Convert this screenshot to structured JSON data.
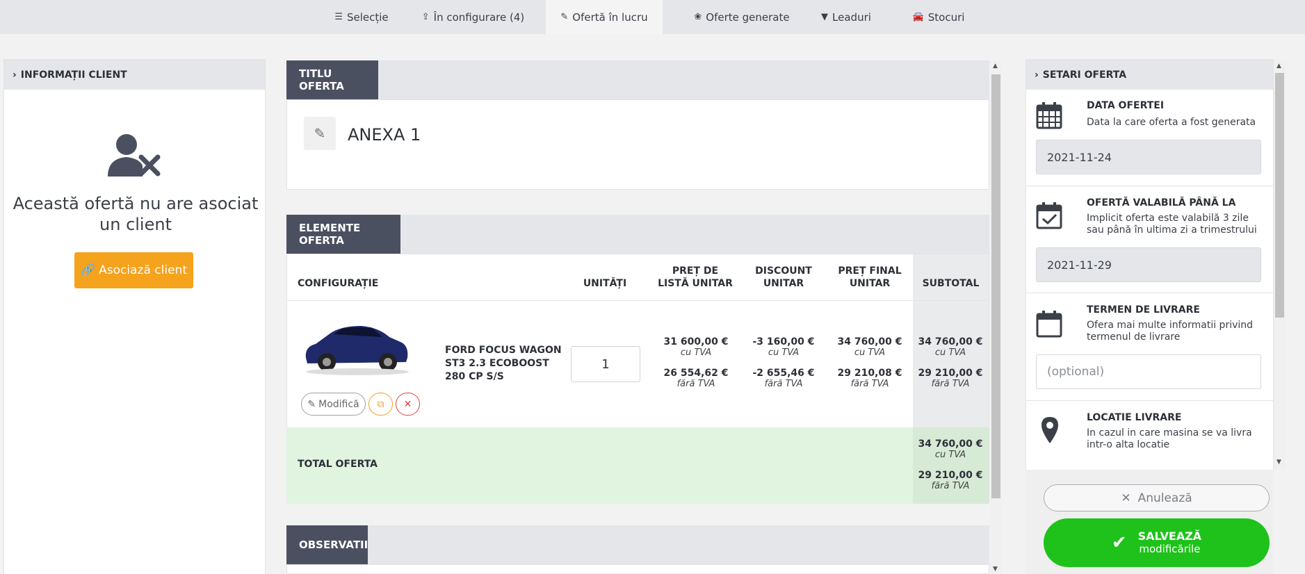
{
  "nav": {
    "tabs": [
      {
        "label": "Selecție",
        "icon": "list-icon"
      },
      {
        "label": "În configurare (4)",
        "icon": "upload-icon"
      },
      {
        "label": "Ofertă în lucru",
        "icon": "edit-square-icon"
      },
      {
        "label": "Oferte generate",
        "icon": "paw-icon"
      },
      {
        "label": "Leaduri",
        "icon": "filter-icon"
      },
      {
        "label": "Stocuri",
        "icon": "car-icon"
      }
    ],
    "active_tab": "Ofertă în lucru"
  },
  "client_panel": {
    "title": "INFORMAȚII CLIENT",
    "empty_message": "Această ofertă nu are asociat un client",
    "associate_button": "Asociază client"
  },
  "offer_title_section": {
    "tab_label": "TITLU OFERTA",
    "title": "ANEXA 1"
  },
  "offer_items_section": {
    "tab_label": "ELEMENTE OFERTA",
    "columns": {
      "config": "CONFIGURAȚIE",
      "units": "UNITĂȚI",
      "list_price_1": "PREȚ DE",
      "list_price_2": "LISTĂ UNITAR",
      "discount_1": "DISCOUNT",
      "discount_2": "UNITAR",
      "final_1": "PREȚ FINAL",
      "final_2": "UNITAR",
      "subtotal": "SUBTOTAL"
    },
    "item": {
      "name_1": "FORD FOCUS WAGON",
      "name_2": "ST3 2.3 ECOBOOST",
      "name_3": "280 CP S/S",
      "units": "1",
      "list_price_vat": "31 600,00 €",
      "list_price_novat": "26 554,62 €",
      "discount_vat": "-3 160,00 €",
      "discount_novat": "-2 655,46 €",
      "final_vat": "34 760,00 €",
      "final_novat": "29 210,08 €",
      "subtotal_vat": "34 760,00 €",
      "subtotal_novat": "29 210,00 €",
      "modify_button": "Modifică"
    },
    "vat_label": "cu TVA",
    "novat_label": "fără TVA",
    "total": {
      "label": "TOTAL OFERTA",
      "vat": "34 760,00 €",
      "novat": "29 210,00 €"
    }
  },
  "observations_section": {
    "tab_label": "OBSERVATII"
  },
  "settings_panel": {
    "title": "SETARI OFERTA",
    "items": [
      {
        "title": "DATA OFERTEI",
        "desc": "Data la care oferta a fost generata",
        "value": "2021-11-24",
        "icon": "calendar-icon"
      },
      {
        "title": "OFERTĂ VALABILĂ PÂNĂ LA",
        "desc": "Implicit oferta este valabilă 3 zile sau până în ultima zi a trimestrului",
        "value": "2021-11-29",
        "icon": "calendar-check-icon"
      },
      {
        "title": "TERMEN DE LIVRARE",
        "desc": "Ofera mai multe informatii privind termenul de livrare",
        "placeholder": "(optional)",
        "icon": "calendar-blank-icon"
      },
      {
        "title": "LOCATIE LIVRARE",
        "desc": "In cazul in care masina se va livra intr-o alta locatie",
        "icon": "map-marker-icon"
      }
    ],
    "cancel_button": "Anulează",
    "save_line1": "SALVEAZĂ",
    "save_line2": "modificările"
  },
  "colors": {
    "accent_orange": "#f5a21c",
    "save_green": "#1ec21a",
    "section_tab": "#4b5061",
    "total_row": "#e0f4df"
  }
}
